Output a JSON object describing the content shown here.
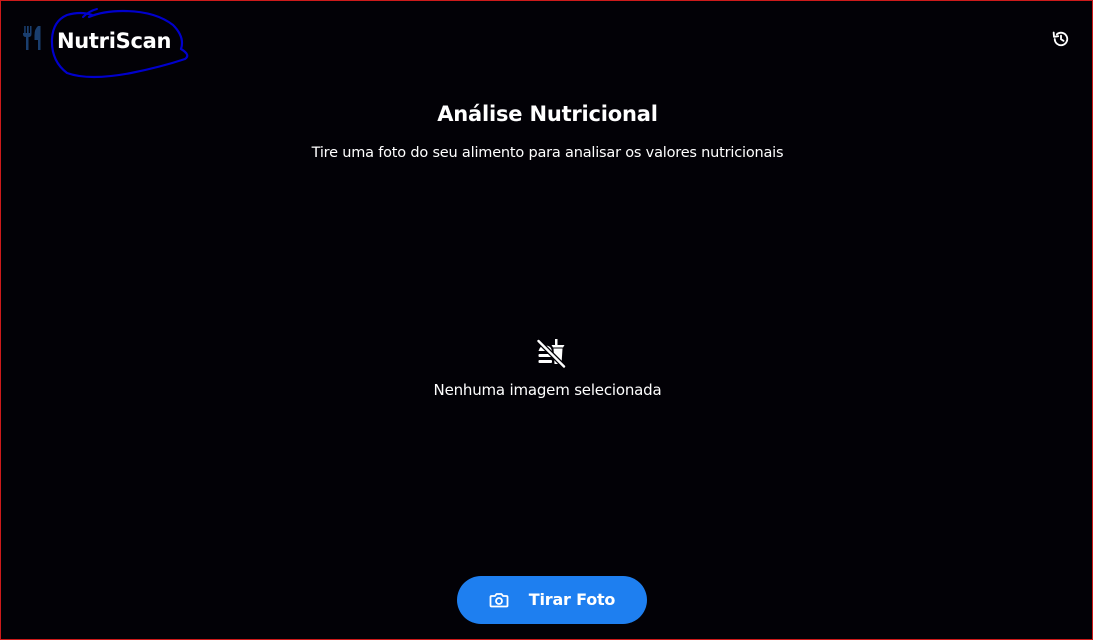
{
  "header": {
    "app_title": "NutriScan",
    "logo_icon": "restaurant-icon",
    "history_icon": "history-icon"
  },
  "main": {
    "title": "Análise Nutricional",
    "subtitle": "Tire uma foto do seu alimento para analisar os valores nutricionais",
    "empty_state": {
      "icon": "no-food-icon",
      "text": "Nenhuma imagem selecionada"
    },
    "action_button": {
      "icon": "camera-icon",
      "label": "Tirar Foto"
    }
  },
  "colors": {
    "background": "#020106",
    "primary": "#1e7ff0",
    "text": "#ffffff",
    "logo": "#1a3e6e",
    "annotation": "#0000cc",
    "frame_border": "#cc1a1a"
  }
}
